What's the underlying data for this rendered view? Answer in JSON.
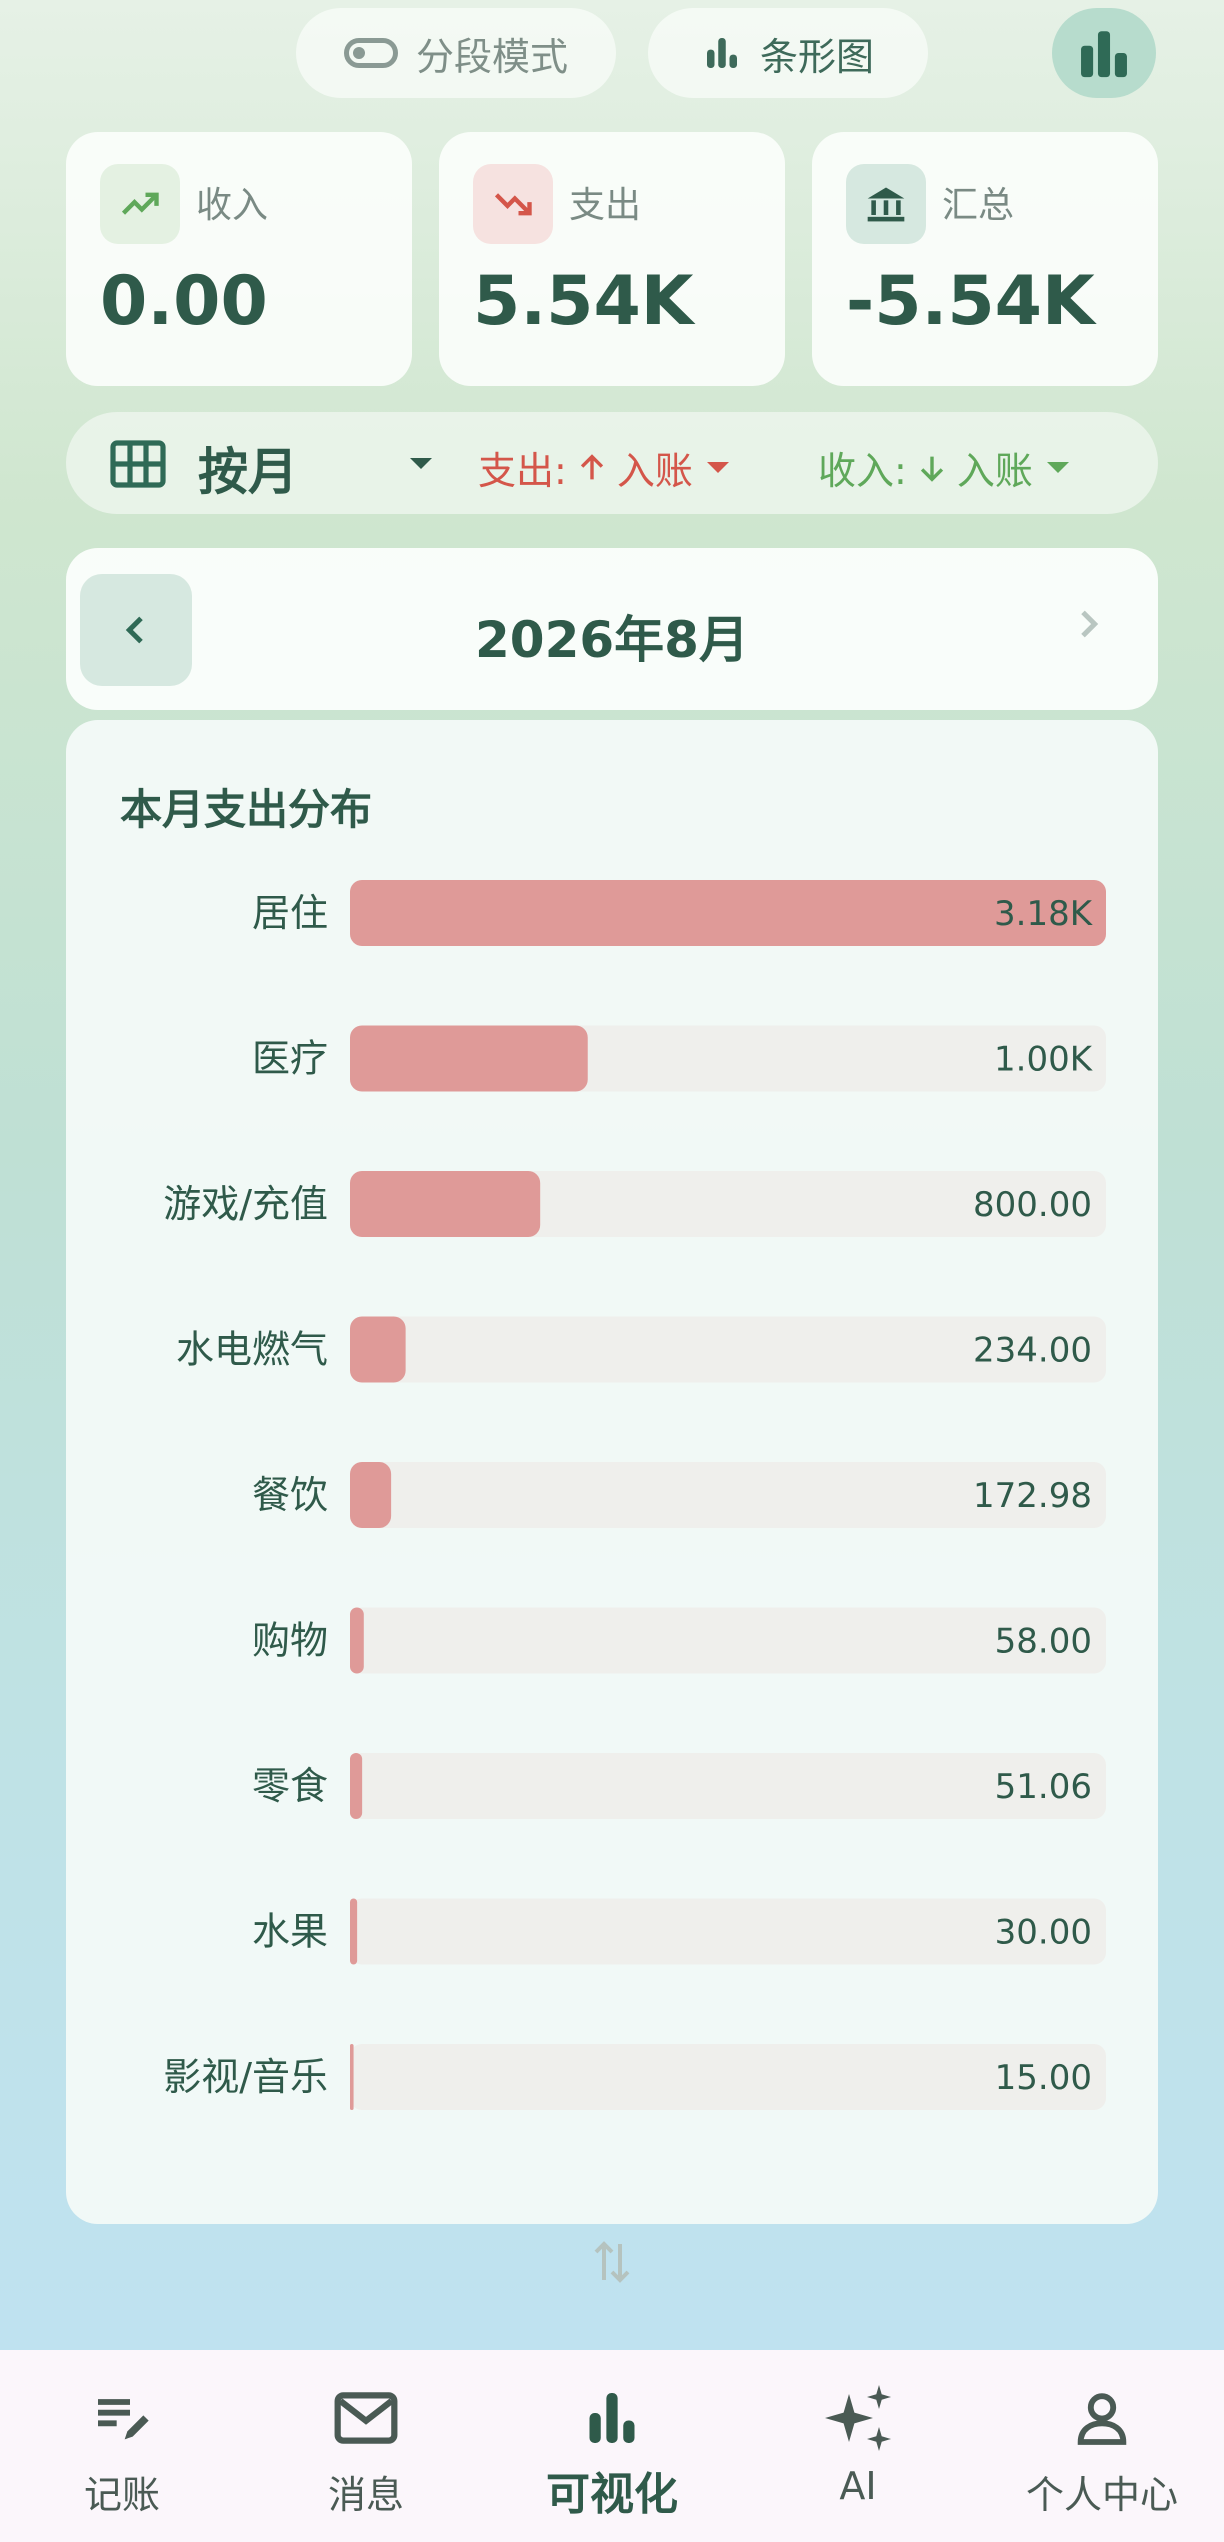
{
  "toggles": {
    "segment_label": "分段模式",
    "chart_label": "条形图"
  },
  "summary": {
    "income": {
      "label": "收入",
      "value": "0.00",
      "icon": "trending-up-icon"
    },
    "expense": {
      "label": "支出",
      "value": "5.54K",
      "icon": "trending-down-icon"
    },
    "total": {
      "label": "汇总",
      "value": "-5.54K",
      "icon": "bank-icon"
    }
  },
  "filter": {
    "period": "按月",
    "expense_label": "支出:",
    "expense_direction": "入账",
    "income_label": "收入:",
    "income_direction": "入账"
  },
  "month": {
    "title": "2026年8月"
  },
  "panel": {
    "title": "本月支出分布"
  },
  "colors": {
    "accent": "#2f5a4a",
    "expense_red": "#d4564a",
    "income_green": "#5fa85a",
    "bar_fill": "#df9a98",
    "bar_track": "#efefec"
  },
  "chart_data": {
    "type": "bar",
    "orientation": "horizontal",
    "categories": [
      "居住",
      "医疗",
      "游戏/充值",
      "水电燃气",
      "餐饮",
      "购物",
      "零食",
      "水果",
      "影视/音乐"
    ],
    "values": [
      3180,
      1000,
      800,
      234,
      172.98,
      58,
      51.06,
      30,
      15
    ],
    "value_labels": [
      "3.18K",
      "1.00K",
      "800.00",
      "234.00",
      "172.98",
      "58.00",
      "51.06",
      "30.00",
      "15.00"
    ],
    "title": "本月支出分布"
  },
  "bottom_nav": {
    "items": [
      {
        "label": "记账",
        "icon": "edit-note-icon"
      },
      {
        "label": "消息",
        "icon": "mail-icon"
      },
      {
        "label": "可视化",
        "icon": "bar-chart-icon",
        "active": true
      },
      {
        "label": "AI",
        "icon": "sparkle-icon"
      },
      {
        "label": "个人中心",
        "icon": "person-icon"
      }
    ]
  }
}
